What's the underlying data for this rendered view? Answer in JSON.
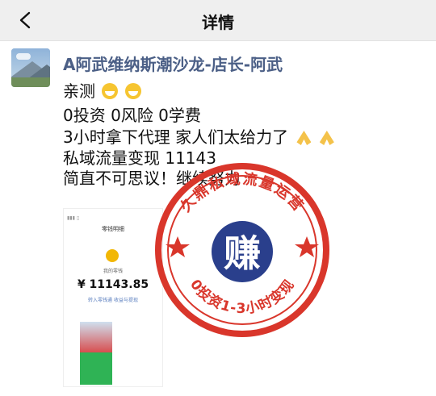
{
  "topbar": {
    "title": "详情"
  },
  "post": {
    "author": "A阿武维纳斯潮沙龙-店长-阿武",
    "lines": [
      "亲测",
      "0投资  0风险  0学费",
      "3小时拿下代理 家人们太给力了",
      "私域流量变现 11143",
      "简直不可思议！继续努力"
    ]
  },
  "screenshot": {
    "header": "零钱明细",
    "label": "我的零钱",
    "amount": "¥ 11143.85",
    "links": "转入零钱通  收益与提现"
  },
  "stamp": {
    "top_text": "久鼎私域流量运营",
    "center_text": "赚",
    "bottom_text": "0投资1-3小时变现",
    "color": "#d9362b",
    "center_color": "#2a3f8c"
  },
  "icons": {
    "back": "chevron-left-icon"
  }
}
